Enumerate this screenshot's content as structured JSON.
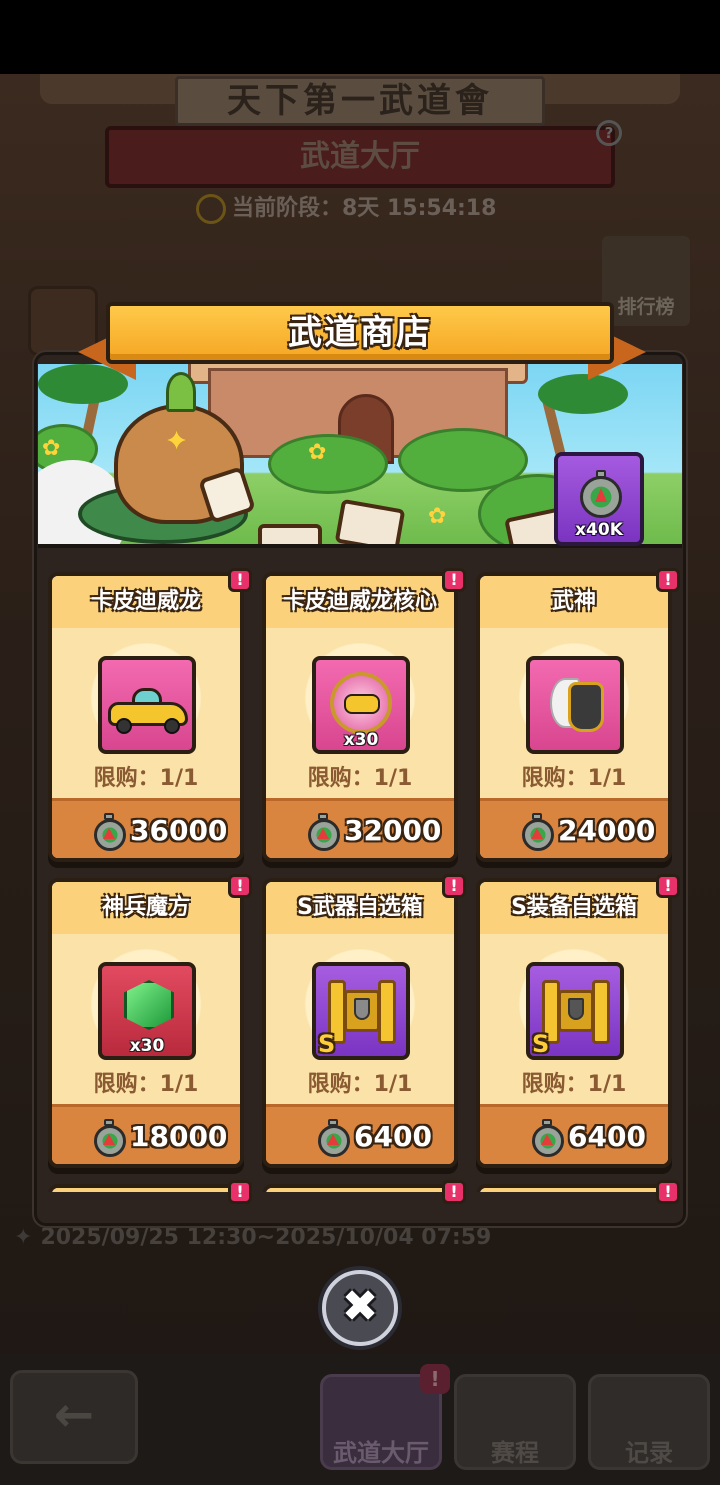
{
  "background": {
    "signboard": "天下第一武道會",
    "hall_title": "武道大厅",
    "help_label": "?",
    "phase_text": "当前阶段：8天 15:54:18",
    "ranking_label": "排行榜",
    "event_dates": "2025/09/25 12:30~2025/10/04 07:59",
    "back_label": "←",
    "tabs": [
      {
        "label": "武道大厅",
        "icon": "hut-icon",
        "badge": "!"
      },
      {
        "label": "赛程",
        "icon": "trophy-icon"
      },
      {
        "label": "记录",
        "icon": "replay-icon"
      }
    ]
  },
  "shop": {
    "title": "武道商店",
    "currency": {
      "icon": "stopwatch-icon",
      "amount": "x40K"
    },
    "items": [
      {
        "name": "卡皮迪威龙",
        "limit": "限购：1/1",
        "price": "36000",
        "qty": "",
        "grade": "",
        "icon": "car-icon",
        "frame": "pink",
        "badge": "!"
      },
      {
        "name": "卡皮迪威龙核心",
        "limit": "限购：1/1",
        "price": "32000",
        "qty": "x30",
        "grade": "",
        "icon": "car-core-icon",
        "frame": "pink",
        "badge": "!"
      },
      {
        "name": "武神",
        "limit": "限购：1/1",
        "price": "24000",
        "qty": "",
        "grade": "",
        "icon": "knight-helmet-icon",
        "frame": "pink",
        "badge": "!"
      },
      {
        "name": "神兵魔方",
        "limit": "限购：1/1",
        "price": "18000",
        "qty": "x30",
        "grade": "",
        "icon": "green-gem-icon",
        "frame": "red",
        "badge": "!"
      },
      {
        "name": "S武器自选箱",
        "limit": "限购：1/1",
        "price": "6400",
        "qty": "",
        "grade": "S",
        "icon": "weapon-chest-icon",
        "frame": "purple",
        "badge": "!"
      },
      {
        "name": "S装备自选箱",
        "limit": "限购：1/1",
        "price": "6400",
        "qty": "",
        "grade": "S",
        "icon": "armor-chest-icon",
        "frame": "purple",
        "badge": "!"
      }
    ],
    "more_badges": [
      "!",
      "!",
      "!"
    ]
  },
  "close_label": "✖",
  "colors": {
    "title_gold": "#f5a623",
    "card_bg": "#f5c98a",
    "price_bar": "#d9843f",
    "badge_red": "#e8316a",
    "currency_purple": "#8b44cf"
  }
}
